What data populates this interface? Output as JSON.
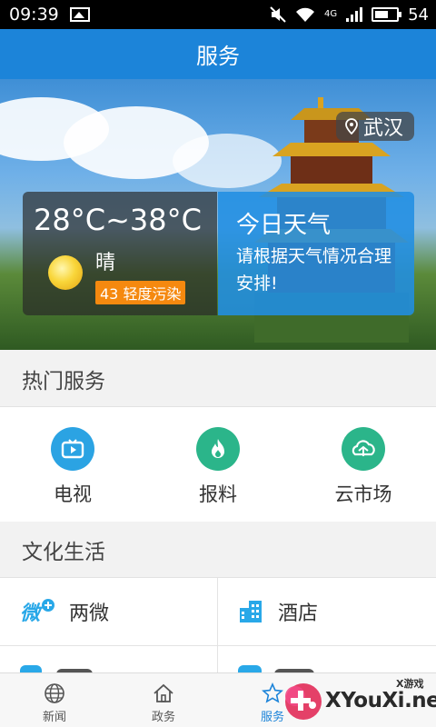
{
  "status_bar": {
    "time": "09:39",
    "network": "4G",
    "battery": "54"
  },
  "header": {
    "title": "服务"
  },
  "banner": {
    "location": "武汉",
    "weather": {
      "temperature": "28°C~38°C",
      "condition": "晴",
      "air_quality": "43 轻度污染"
    },
    "tip": {
      "title": "今日天气",
      "text": "请根据天气情况合理安排!"
    }
  },
  "hot_services": {
    "title": "热门服务",
    "items": [
      {
        "label": "电视",
        "icon": "tv-icon",
        "color": "#2ba3e3"
      },
      {
        "label": "报料",
        "icon": "flame-icon",
        "color": "#2bb58a"
      },
      {
        "label": "云市场",
        "icon": "cloud-market-icon",
        "color": "#2bb58a"
      }
    ]
  },
  "culture_life": {
    "title": "文化生活",
    "items": [
      {
        "label": "两微",
        "icon": "weibo-weixin-icon",
        "color": "#29a8e8"
      },
      {
        "label": "酒店",
        "icon": "hotel-building-icon",
        "color": "#29a8e8"
      }
    ]
  },
  "bottom_nav": {
    "items": [
      {
        "label": "新闻",
        "icon": "globe-icon",
        "active": false
      },
      {
        "label": "政务",
        "icon": "home-icon",
        "active": false
      },
      {
        "label": "服务",
        "icon": "star-icon",
        "active": true
      },
      {
        "label": "",
        "icon": "",
        "active": false
      }
    ]
  },
  "watermark": {
    "brand": "XYouXi.net",
    "tag": "X游戏"
  }
}
